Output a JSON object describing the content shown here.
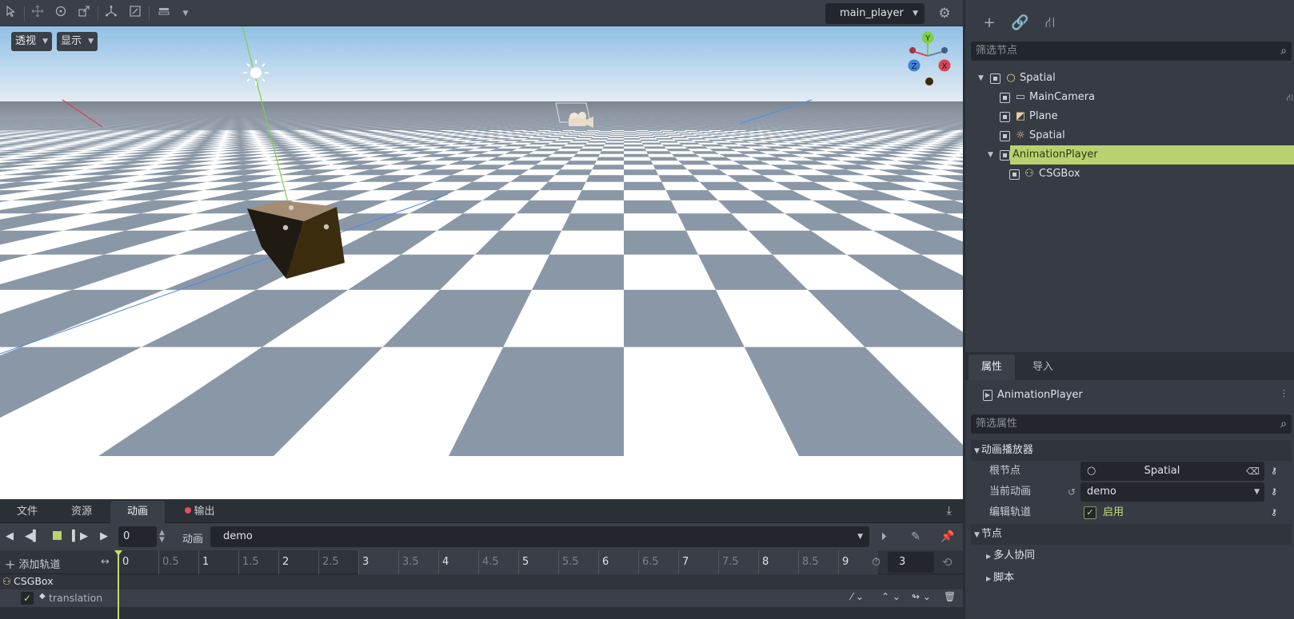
{
  "toolbar": {
    "icons": [
      "select-icon",
      "move-icon",
      "rotate-icon",
      "scale-icon",
      "local-space-icon",
      "snap-icon",
      "view-icon",
      "view-menu-icon"
    ],
    "player_select": "main_player"
  },
  "viewport": {
    "perspective_label": "透视",
    "display_label": "显示",
    "gizmo": {
      "y": "Y",
      "z": "Z",
      "x": "X"
    }
  },
  "bottom_tabs": [
    {
      "label": "文件"
    },
    {
      "label": "资源"
    },
    {
      "label": "动画",
      "active": true
    },
    {
      "label": "输出"
    }
  ],
  "animation": {
    "time_value": "0",
    "anim_label": "动画",
    "current_anim": "demo",
    "add_track": "添加轨道",
    "ruler": [
      "0",
      "0.5",
      "1",
      "1.5",
      "2",
      "2.5",
      "3",
      "3.5",
      "4",
      "4.5",
      "5",
      "5.5",
      "6",
      "6.5",
      "7",
      "7.5",
      "8",
      "8.5",
      "9"
    ],
    "length": "3",
    "playhead_time": 0,
    "node": "CSGBox",
    "track": "translation",
    "track_enabled": true
  },
  "scene": {
    "filter_placeholder": "筛选节点",
    "tree": [
      {
        "label": "Spatial",
        "icon": "spatial-node-icon",
        "depth": 0,
        "expanded": true
      },
      {
        "label": "MainCamera",
        "icon": "camera-node-icon",
        "depth": 1
      },
      {
        "label": "Plane",
        "icon": "mesh-node-icon",
        "depth": 1
      },
      {
        "label": "Spatial",
        "icon": "light-node-icon",
        "depth": 1
      },
      {
        "label": "AnimationPlayer",
        "icon": "animation-player-icon",
        "depth": 1,
        "selected": true,
        "expanded": true
      },
      {
        "label": "CSGBox",
        "icon": "csg-box-icon",
        "depth": 2
      }
    ]
  },
  "inspector": {
    "tabs": [
      {
        "label": "属性",
        "active": true
      },
      {
        "label": "导入"
      }
    ],
    "object_name": "AnimationPlayer",
    "filter_placeholder": "筛选属性",
    "section_main": "动画播放器",
    "root_node_label": "根节点",
    "root_node_value": "Spatial",
    "current_anim_label": "当前动画",
    "current_anim_value": "demo",
    "edit_track_label": "编辑轨道",
    "edit_track_value": "启用",
    "section_node": "节点",
    "sub_multiplayer": "多人协同",
    "sub_script": "脚本"
  },
  "colors": {
    "selection": "#b7d26f",
    "playhead": "#c2dc74",
    "box": "#3b2c0e",
    "sky_top": "#8fc0e6",
    "checker_dark": "#8a97a6"
  }
}
